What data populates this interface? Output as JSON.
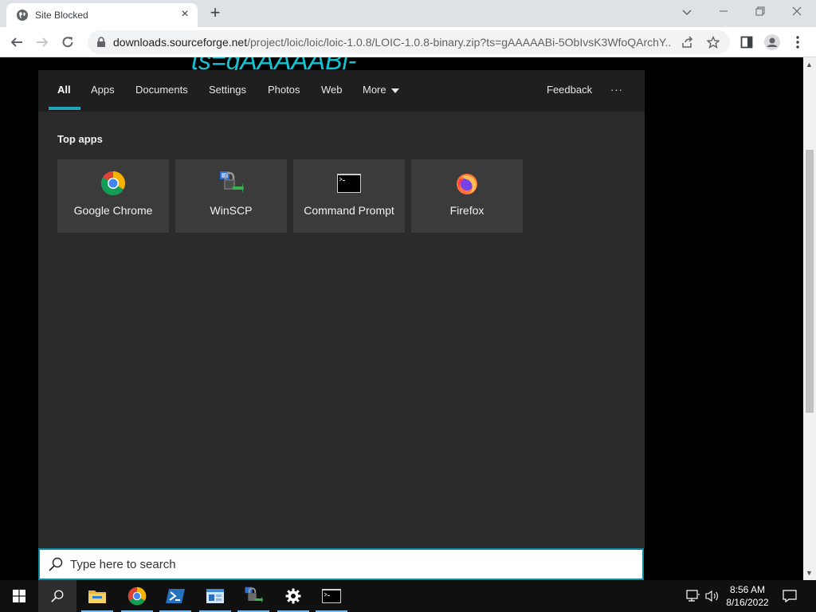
{
  "browser": {
    "tab_title": "Site Blocked",
    "url_host": "downloads.sourceforge.net",
    "url_path": "/project/loic/loic/loic-1.0.8/LOIC-1.0.8-binary.zip?ts=gAAAAABi-5ObIvsK3WfoQArchY..."
  },
  "page": {
    "background_text": "ts=gAAAAABi-"
  },
  "search_panel": {
    "tabs": [
      {
        "label": "All"
      },
      {
        "label": "Apps"
      },
      {
        "label": "Documents"
      },
      {
        "label": "Settings"
      },
      {
        "label": "Photos"
      },
      {
        "label": "Web"
      },
      {
        "label": "More"
      }
    ],
    "feedback_label": "Feedback",
    "overflow_label": "···",
    "section_title": "Top apps",
    "apps": [
      {
        "label": "Google Chrome",
        "icon": "chrome-icon"
      },
      {
        "label": "WinSCP",
        "icon": "winscp-icon"
      },
      {
        "label": "Command Prompt",
        "icon": "command-prompt-icon"
      },
      {
        "label": "Firefox",
        "icon": "firefox-icon"
      }
    ],
    "search_placeholder": "Type here to search"
  },
  "taskbar": {
    "time": "8:56 AM",
    "date": "8/16/2022"
  },
  "colors": {
    "accent": "#20a3b8",
    "panel_bg": "#2b2b2b",
    "taskbar_bg": "#101010",
    "page_text": "#17c3d1"
  }
}
